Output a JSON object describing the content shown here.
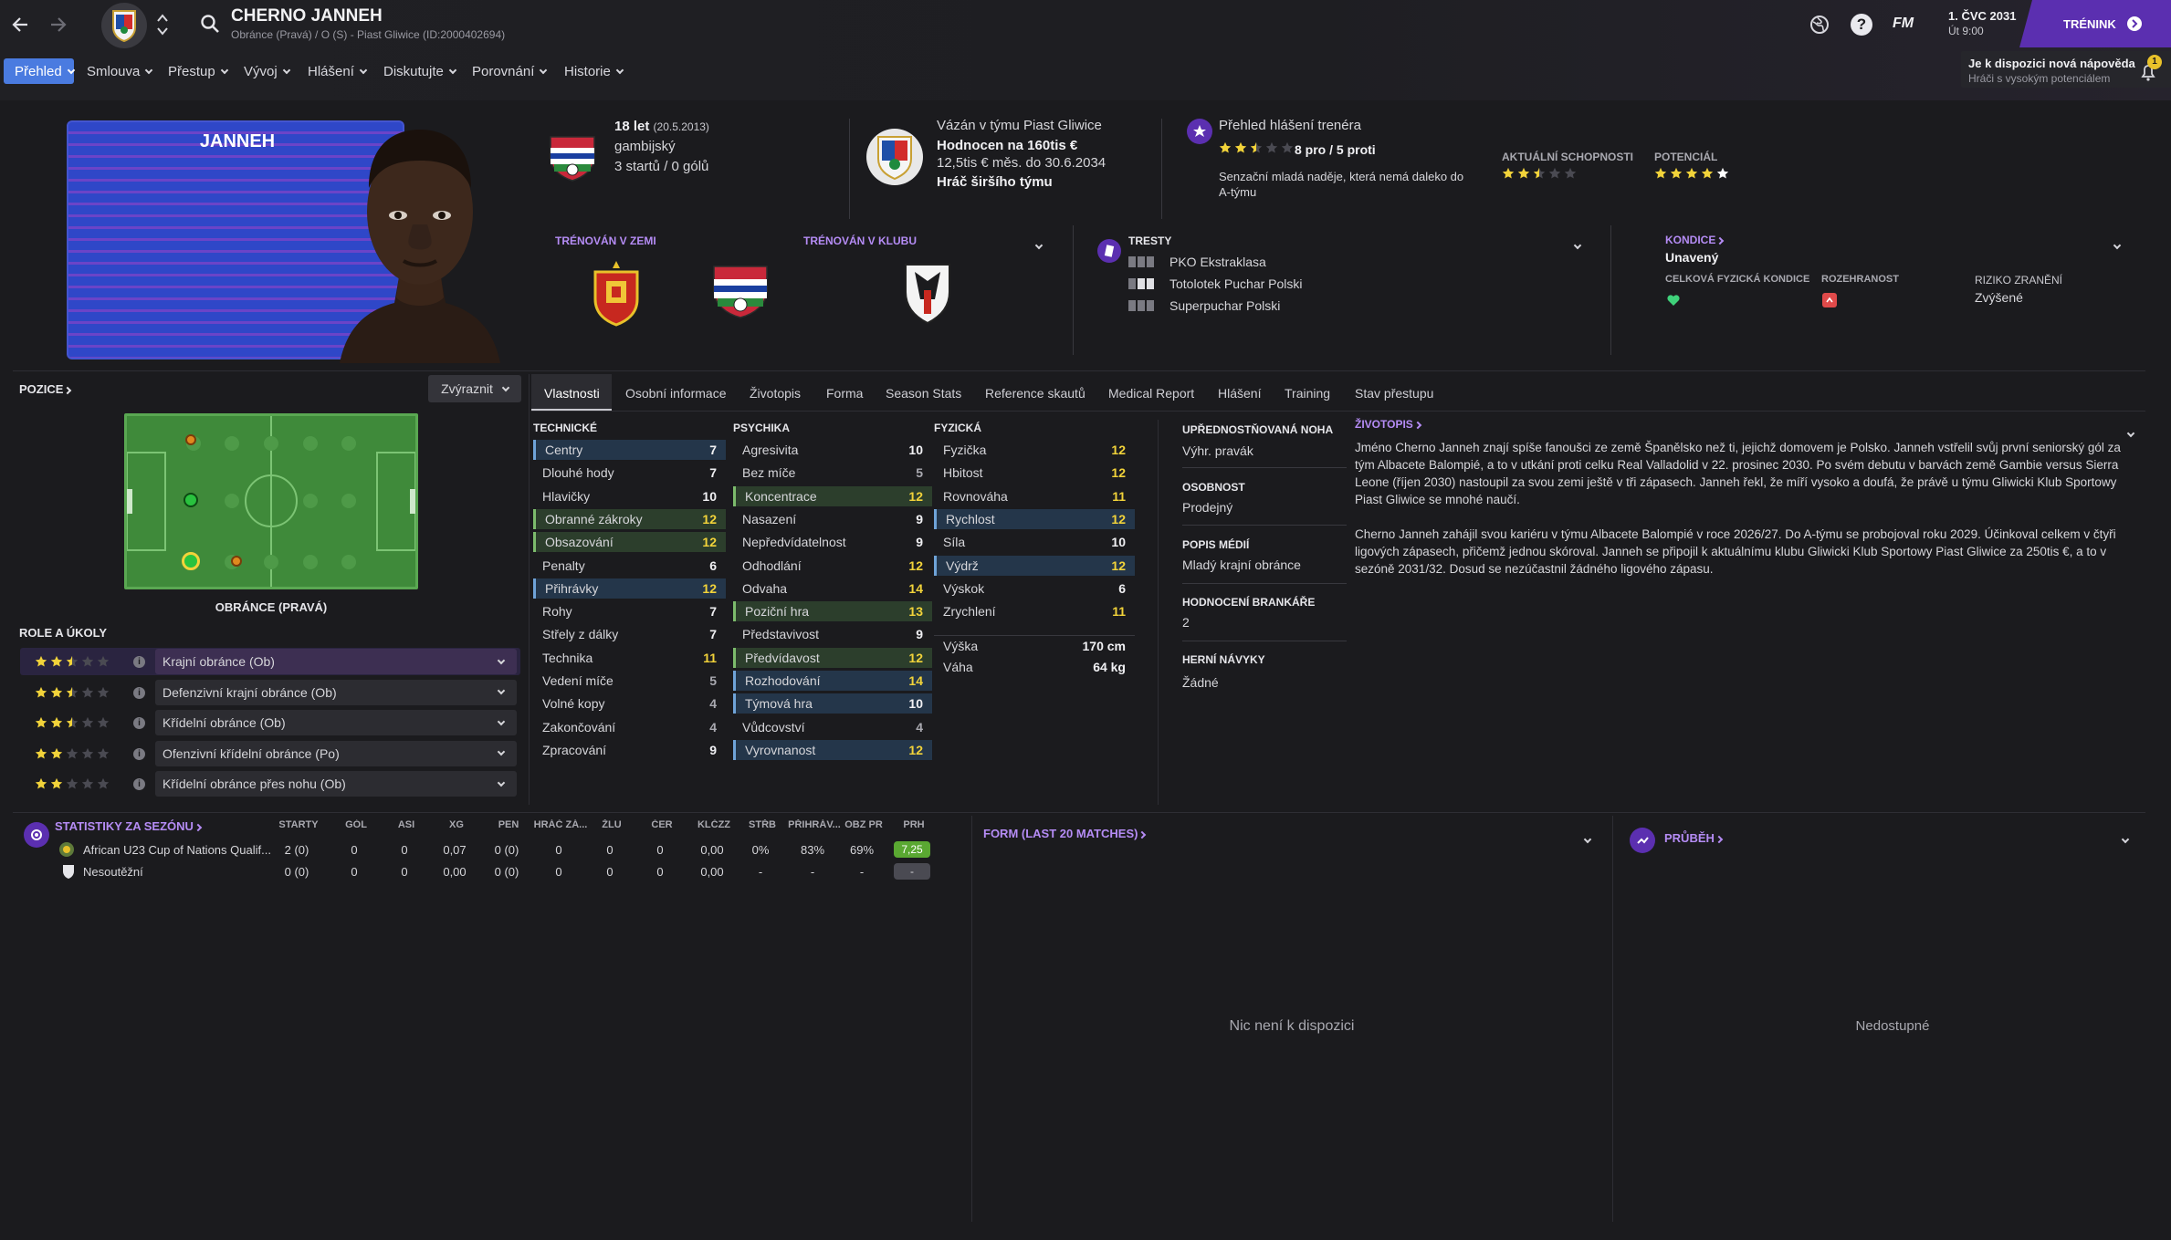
{
  "header": {
    "player_name": "CHERNO JANNEH",
    "player_sub": "Obránce (Pravá) / O (S) - Piast Gliwice (ID:2000402694)",
    "date": "1. ČVC 2031",
    "day_time": "Út 9:00",
    "continue_label": "TRÉNINK",
    "fm_label": "FM",
    "notif_title": "Je k dispozici nová nápověda",
    "notif_sub": "Hráči s vysokým potenciálem",
    "notif_count": "1"
  },
  "nav": [
    "Přehled",
    "Smlouva",
    "Přestup",
    "Vývoj",
    "Hlášení",
    "Diskutujte",
    "Porovnání",
    "Historie"
  ],
  "card": {
    "surname": "JANNEH"
  },
  "bio": {
    "age": "18 let",
    "dob": "(20.5.2013)",
    "nationality": "gambijský",
    "caps": "3 startů / 0 gólů"
  },
  "contract": {
    "club": "Vázán v týmu Piast Gliwice",
    "value": "Hodnocen na 160tis €",
    "wage": "12,5tis € měs. do 30.6.2034",
    "status": "Hráč širšího týmu"
  },
  "coach": {
    "title": "Přehled hlášení trenéra",
    "stars": 2.5,
    "procon": "8 pro / 5 proti",
    "text": "Senzační mladá naděje, která nemá daleko do A-týmu",
    "ability_label": "AKTUÁLNÍ SCHOPNOSTI",
    "ability_stars": 2.5,
    "potential_label": "POTENCIÁL",
    "potential_stars": 5
  },
  "trained": {
    "country_label": "TRÉNOVÁN V ZEMI",
    "club_label": "TRÉNOVÁN V KLUBU"
  },
  "bans": {
    "title": "TRESTY",
    "items": [
      "PKO Ekstraklasa",
      "Totolotek Puchar Polski",
      "Superpuchar Polski"
    ]
  },
  "condition": {
    "title": "KONDICE",
    "value": "Unavený",
    "overall_label": "CELKOVÁ FYZICKÁ KONDICE",
    "sharpness_label": "ROZEHRANOST",
    "injury_label": "RIZIKO ZRANĚNÍ",
    "injury_value": "Zvýšené"
  },
  "position": {
    "title": "POZICE",
    "highlight": "Zvýraznit",
    "label": "OBRÁNCE (PRAVÁ)"
  },
  "roles": {
    "title": "ROLE A ÚKOLY",
    "items": [
      {
        "label": "Krajní obránce (Ob)",
        "stars": 2.5
      },
      {
        "label": "Defenzivní krajní obránce (Ob)",
        "stars": 2.5
      },
      {
        "label": "Křídelní obránce (Ob)",
        "stars": 2.5
      },
      {
        "label": "Ofenzivní křídelní obránce (Po)",
        "stars": 2
      },
      {
        "label": "Křídelní obránce přes nohu (Ob)",
        "stars": 2
      }
    ]
  },
  "tabs": [
    "Vlastnosti",
    "Osobní informace",
    "Životopis",
    "Forma",
    "Season Stats",
    "Reference skautů",
    "Medical Report",
    "Hlášení",
    "Training",
    "Stav přestupu"
  ],
  "attributes": {
    "technical_title": "TECHNICKÉ",
    "technical": [
      {
        "name": "Centry",
        "value": "7",
        "hl": "b"
      },
      {
        "name": "Dlouhé hody",
        "value": "7",
        "hl": ""
      },
      {
        "name": "Hlavičky",
        "value": "10",
        "hl": ""
      },
      {
        "name": "Obranné zákroky",
        "value": "12",
        "hl": "g"
      },
      {
        "name": "Obsazování",
        "value": "12",
        "hl": "g"
      },
      {
        "name": "Penalty",
        "value": "6",
        "hl": ""
      },
      {
        "name": "Přihrávky",
        "value": "12",
        "hl": "b"
      },
      {
        "name": "Rohy",
        "value": "7",
        "hl": ""
      },
      {
        "name": "Střely z dálky",
        "value": "7",
        "hl": ""
      },
      {
        "name": "Technika",
        "value": "11",
        "hl": ""
      },
      {
        "name": "Vedení míče",
        "value": "5",
        "hl": ""
      },
      {
        "name": "Volné kopy",
        "value": "4",
        "hl": ""
      },
      {
        "name": "Zakončování",
        "value": "4",
        "hl": ""
      },
      {
        "name": "Zpracování",
        "value": "9",
        "hl": ""
      }
    ],
    "mental_title": "PSYCHIKA",
    "mental": [
      {
        "name": "Agresivita",
        "value": "10",
        "hl": ""
      },
      {
        "name": "Bez míče",
        "value": "5",
        "hl": ""
      },
      {
        "name": "Koncentrace",
        "value": "12",
        "hl": "g"
      },
      {
        "name": "Nasazení",
        "value": "9",
        "hl": ""
      },
      {
        "name": "Nepředvídatelnost",
        "value": "9",
        "hl": ""
      },
      {
        "name": "Odhodlání",
        "value": "12",
        "hl": ""
      },
      {
        "name": "Odvaha",
        "value": "14",
        "hl": ""
      },
      {
        "name": "Poziční hra",
        "value": "13",
        "hl": "g"
      },
      {
        "name": "Představivost",
        "value": "9",
        "hl": ""
      },
      {
        "name": "Předvídavost",
        "value": "12",
        "hl": "g"
      },
      {
        "name": "Rozhodování",
        "value": "14",
        "hl": "b"
      },
      {
        "name": "Týmová hra",
        "value": "10",
        "hl": "b"
      },
      {
        "name": "Vůdcovství",
        "value": "4",
        "hl": ""
      },
      {
        "name": "Vyrovnanost",
        "value": "12",
        "hl": "b"
      }
    ],
    "physical_title": "FYZICKÁ",
    "physical": [
      {
        "name": "Fyzička",
        "value": "12",
        "hl": ""
      },
      {
        "name": "Hbitost",
        "value": "12",
        "hl": ""
      },
      {
        "name": "Rovnováha",
        "value": "11",
        "hl": ""
      },
      {
        "name": "Rychlost",
        "value": "12",
        "hl": "b"
      },
      {
        "name": "Síla",
        "value": "10",
        "hl": ""
      },
      {
        "name": "Výdrž",
        "value": "12",
        "hl": "b"
      },
      {
        "name": "Výskok",
        "value": "6",
        "hl": ""
      },
      {
        "name": "Zrychlení",
        "value": "11",
        "hl": ""
      }
    ],
    "height_label": "Výška",
    "height": "170 cm",
    "weight_label": "Váha",
    "weight": "64 kg"
  },
  "info": {
    "foot_label": "UPŘEDNOSTŇOVANÁ NOHA",
    "foot": "Výhr. pravák",
    "personality_label": "OSOBNOST",
    "personality": "Prodejný",
    "media_label": "POPIS MÉDIÍ",
    "media": "Mladý krajní obránce",
    "gk_label": "HODNOCENÍ BRANKÁŘE",
    "gk": "2",
    "habits_label": "HERNÍ NÁVYKY",
    "habits": "Žádné"
  },
  "biography": {
    "title": "ŽIVOTOPIS",
    "p1": "Jméno Cherno Janneh znají spíše fanoušci ze země Španělsko než ti, jejichž domovem je Polsko. Janneh vstřelil svůj první seniorský gól za tým Albacete Balompié, a to v utkání proti celku Real Valladolid v 22. prosinec 2030. Po svém debutu v barvách země Gambie versus Sierra Leone (říjen 2030) nastoupil za svou zemi ještě v tři zápasech. Janneh řekl, že míří vysoko a doufá, že právě u týmu Gliwicki Klub Sportowy Piast Gliwice se mnohé naučí.",
    "p2": "Cherno Janneh zahájil svou kariéru v týmu Albacete Balompié v roce 2026/27. Do A-týmu se probojoval roku 2029. Účinkoval celkem v čtyři ligových zápasech, přičemž jednou skóroval. Janneh se připojil k aktuálnímu klubu Gliwicki Klub Sportowy Piast Gliwice za 250tis €, a to v sezóně 2031/32. Dosud se nezúčastnil žádného ligového zápasu."
  },
  "season_stats": {
    "title": "STATISTIKY ZA SEZÓNU",
    "columns": [
      "STARTY",
      "GÓL",
      "ASI",
      "XG",
      "PEN",
      "HRÁČ ZÁ...",
      "ŽLU",
      "ČER",
      "KLČZZ",
      "STŘB",
      "PŘIHRÁV...",
      "OBZ PR",
      "PRH"
    ],
    "rows": [
      {
        "name": "African U23 Cup of Nations Qualif...",
        "cells": [
          "2 (0)",
          "0",
          "0",
          "0,07",
          "0 (0)",
          "0",
          "0",
          "0",
          "0,00",
          "0%",
          "83%",
          "69%",
          "7,25"
        ]
      },
      {
        "name": "Nesoutěžní",
        "cells": [
          "0 (0)",
          "0",
          "0",
          "0,00",
          "0 (0)",
          "0",
          "0",
          "0",
          "0,00",
          "-",
          "-",
          "-",
          "-"
        ]
      }
    ]
  },
  "form": {
    "title": "FORM (LAST 20 MATCHES)",
    "empty": "Nic není k dispozici"
  },
  "progress": {
    "title": "PRŮBĚH",
    "empty": "Nedostupné"
  },
  "colors": {
    "accent": "#6a3fc1",
    "yellow": "#f2d33a",
    "green": "#7cbb6c",
    "blue": "#6fa3d8",
    "card": "#2f47c8"
  }
}
